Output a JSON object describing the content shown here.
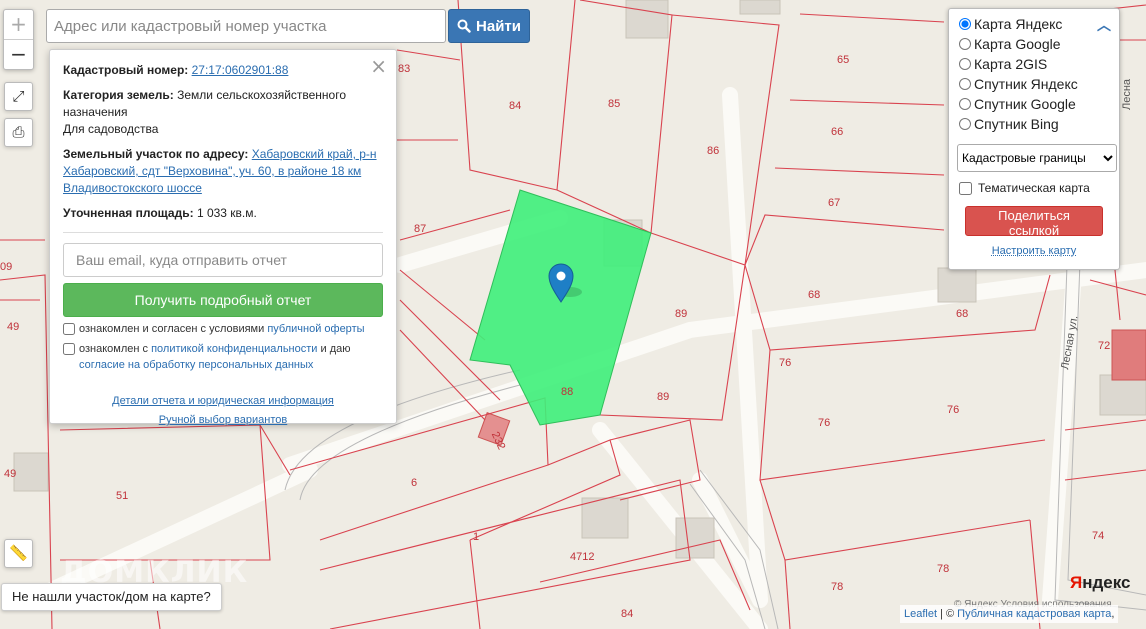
{
  "search": {
    "placeholder": "Адрес или кадастровый номер участка",
    "button_label": "Найти"
  },
  "zoom": {
    "in_label": "+",
    "out_label": "−"
  },
  "popup": {
    "cadastral_label": "Кадастровый номер:",
    "cadastral_number": "27:17:0602901:88",
    "category_label": "Категория земель:",
    "category_value": "Земли сельскохозяйственного назначения",
    "usage": "Для садоводства",
    "address_label": "Земельный участок по адресу:",
    "address_value": "Хабаровский край, р-н Хабаровский, сдт \"Верховина\", уч. 60, в районе 18 км Владивостокского шоссе",
    "area_label": "Уточненная площадь:",
    "area_value": "1 033 кв.м.",
    "email_placeholder": "Ваш email, куда отправить отчет",
    "report_button": "Получить подробный отчет",
    "agree1_text": "ознакомлен и согласен с условиями",
    "agree1_link": "публичной оферты",
    "agree2_text": "ознакомлен с",
    "agree2_link": "политикой конфиденциальности",
    "agree2_mid": "и даю",
    "agree2_link2": "согласие на обработку персональных данных",
    "details_link": "Детали отчета и юридическая информация",
    "manual_link": "Ручной выбор вариантов"
  },
  "layers": {
    "options": [
      "Карта Яндекс",
      "Карта Google",
      "Карта 2GIS",
      "Спутник Яндекс",
      "Спутник Google",
      "Спутник Bing"
    ],
    "selected": "Карта Яндекс",
    "overlay_select": "Кадастровые границы",
    "thematic_label": "Тематическая карта",
    "share_button": "Поделиться ссылкой",
    "configure_link": "Настроить карту"
  },
  "map": {
    "parcel_numbers": [
      "83",
      "84",
      "85",
      "86",
      "65",
      "66",
      "67",
      "68",
      "68",
      "87",
      "88",
      "89",
      "89",
      "76",
      "76",
      "76",
      "72",
      "74",
      "78",
      "78",
      "84",
      "4712",
      "1",
      "6",
      "51",
      "49",
      "49",
      "09",
      "232"
    ],
    "street": "Лесная ул.",
    "street2": "Лесна",
    "colors": {
      "selected_parcel": "#3ef07a",
      "boundary": "#d9434f",
      "background": "#efece4"
    }
  },
  "not_found_button": "Не нашли участок/дом на карте?",
  "watermark": "ДОМКЛИК",
  "yandex_logo": {
    "ya": "Я",
    "rest": "ндекс"
  },
  "terms_text": "© Яндекс Условия использования",
  "attribution": {
    "leaflet": "Leaflet",
    "sep": " | © ",
    "pkk": "Публичная кадастровая карта",
    "comma": ","
  }
}
